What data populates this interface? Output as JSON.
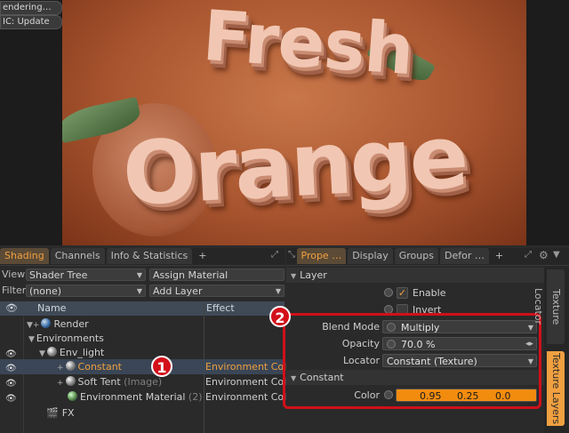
{
  "viewport": {
    "status_rendering": "endering…",
    "status_update": "IC: Update",
    "render_text_line1": "Fresh",
    "render_text_line2": "Orange"
  },
  "left_panel": {
    "tabs": [
      "Shading",
      "Channels",
      "Info & Statistics",
      "+"
    ],
    "active_tab": "Shading",
    "view_label": "View",
    "view_value": "Shader Tree",
    "assign_material_label": "Assign Material",
    "filter_label": "Filter",
    "filter_value": "(none)",
    "add_layer_label": "Add Layer",
    "columns": {
      "name": "Name",
      "effect": "Effect"
    },
    "tree": [
      {
        "name": "Render",
        "effect": "",
        "icon": "render-ball-icon"
      },
      {
        "name": "Environments",
        "effect": ""
      },
      {
        "name": "Env_light",
        "effect": "",
        "icon": "environment-ball-icon"
      },
      {
        "name": "Constant",
        "suffix": "",
        "effect": "Environment Color",
        "selected": true,
        "icon": "constant-ball-icon"
      },
      {
        "name": "Soft Tent",
        "suffix": "(Image)",
        "effect": "Environment Color",
        "icon": "image-ball-icon"
      },
      {
        "name": "Environment Material",
        "suffix": "(2)",
        "effect": "Environment Color",
        "icon": "material-ball-icon"
      },
      {
        "name": "FX",
        "effect": "",
        "icon": "fx-clapper-icon"
      }
    ]
  },
  "right_panel": {
    "tabs": [
      "Prope …",
      "Display",
      "Groups",
      "Defor …",
      "+"
    ],
    "active_tab": "Prope …",
    "section_layer": "Layer",
    "enable_label": "Enable",
    "enable_checked": true,
    "invert_label": "Invert",
    "invert_checked": false,
    "blend_mode_label": "Blend Mode",
    "blend_mode_value": "Multiply",
    "opacity_label": "Opacity",
    "opacity_value": "70.0 %",
    "locator_label": "Locator",
    "locator_value": "Constant (Texture)",
    "section_constant": "Constant",
    "color_label": "Color",
    "color_values": [
      "0.95",
      "0.25",
      "0.0"
    ],
    "color_swatch": "#f28c0f"
  },
  "side_tabs": [
    "Texture Locator",
    "Texture Layers"
  ],
  "badges": [
    "1",
    "2"
  ],
  "colors": {
    "accent": "#f0a040",
    "highlight_box": "#d0101a",
    "badge": "#d3101a"
  }
}
